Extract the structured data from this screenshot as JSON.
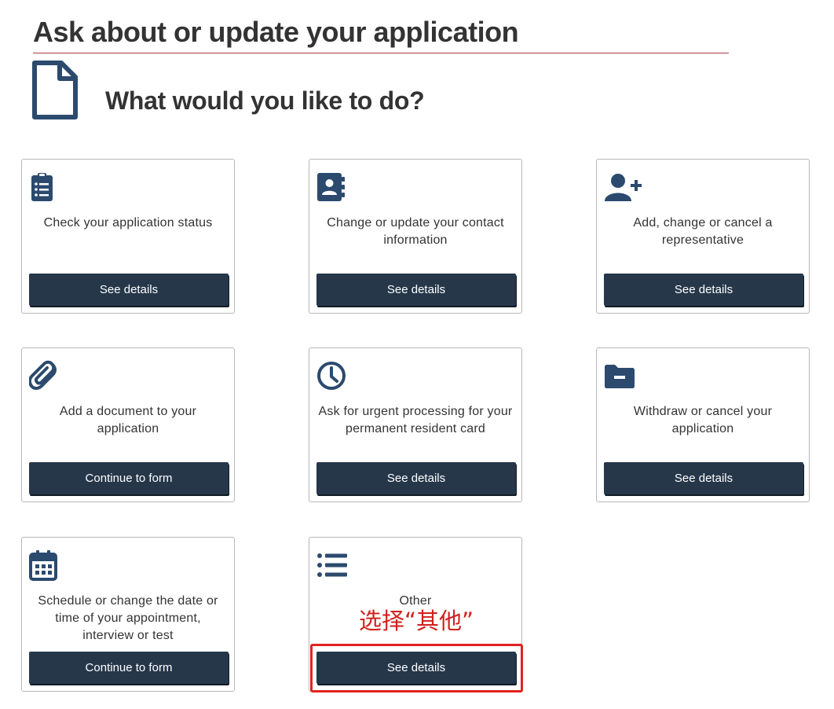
{
  "header": {
    "title": "Ask about or update your application",
    "subtitle": "What would you like to do?"
  },
  "cards": [
    {
      "label": "Check your application status",
      "button": "See details",
      "icon": "clipboard-list-icon"
    },
    {
      "label": "Change or update your contact information",
      "button": "See details",
      "icon": "address-book-icon"
    },
    {
      "label": "Add, change or cancel a representative",
      "button": "See details",
      "icon": "user-plus-icon"
    },
    {
      "label": "Add a document to your application",
      "button": "Continue to form",
      "icon": "paperclip-icon"
    },
    {
      "label": "Ask for urgent processing for your permanent resident card",
      "button": "See details",
      "icon": "clock-icon"
    },
    {
      "label": "Withdraw or cancel your application",
      "button": "See details",
      "icon": "folder-minus-icon"
    },
    {
      "label": "Schedule or change the date or time of your appointment, interview or test",
      "button": "Continue to form",
      "icon": "calendar-icon"
    },
    {
      "label": "Other",
      "button": "See details",
      "icon": "list-icon"
    }
  ],
  "annotation": {
    "text": "选择“其他”",
    "color": "#e0231e"
  },
  "colors": {
    "button_bg": "#26374a",
    "icon": "#2b4a6e",
    "rule": "#af3c43"
  }
}
